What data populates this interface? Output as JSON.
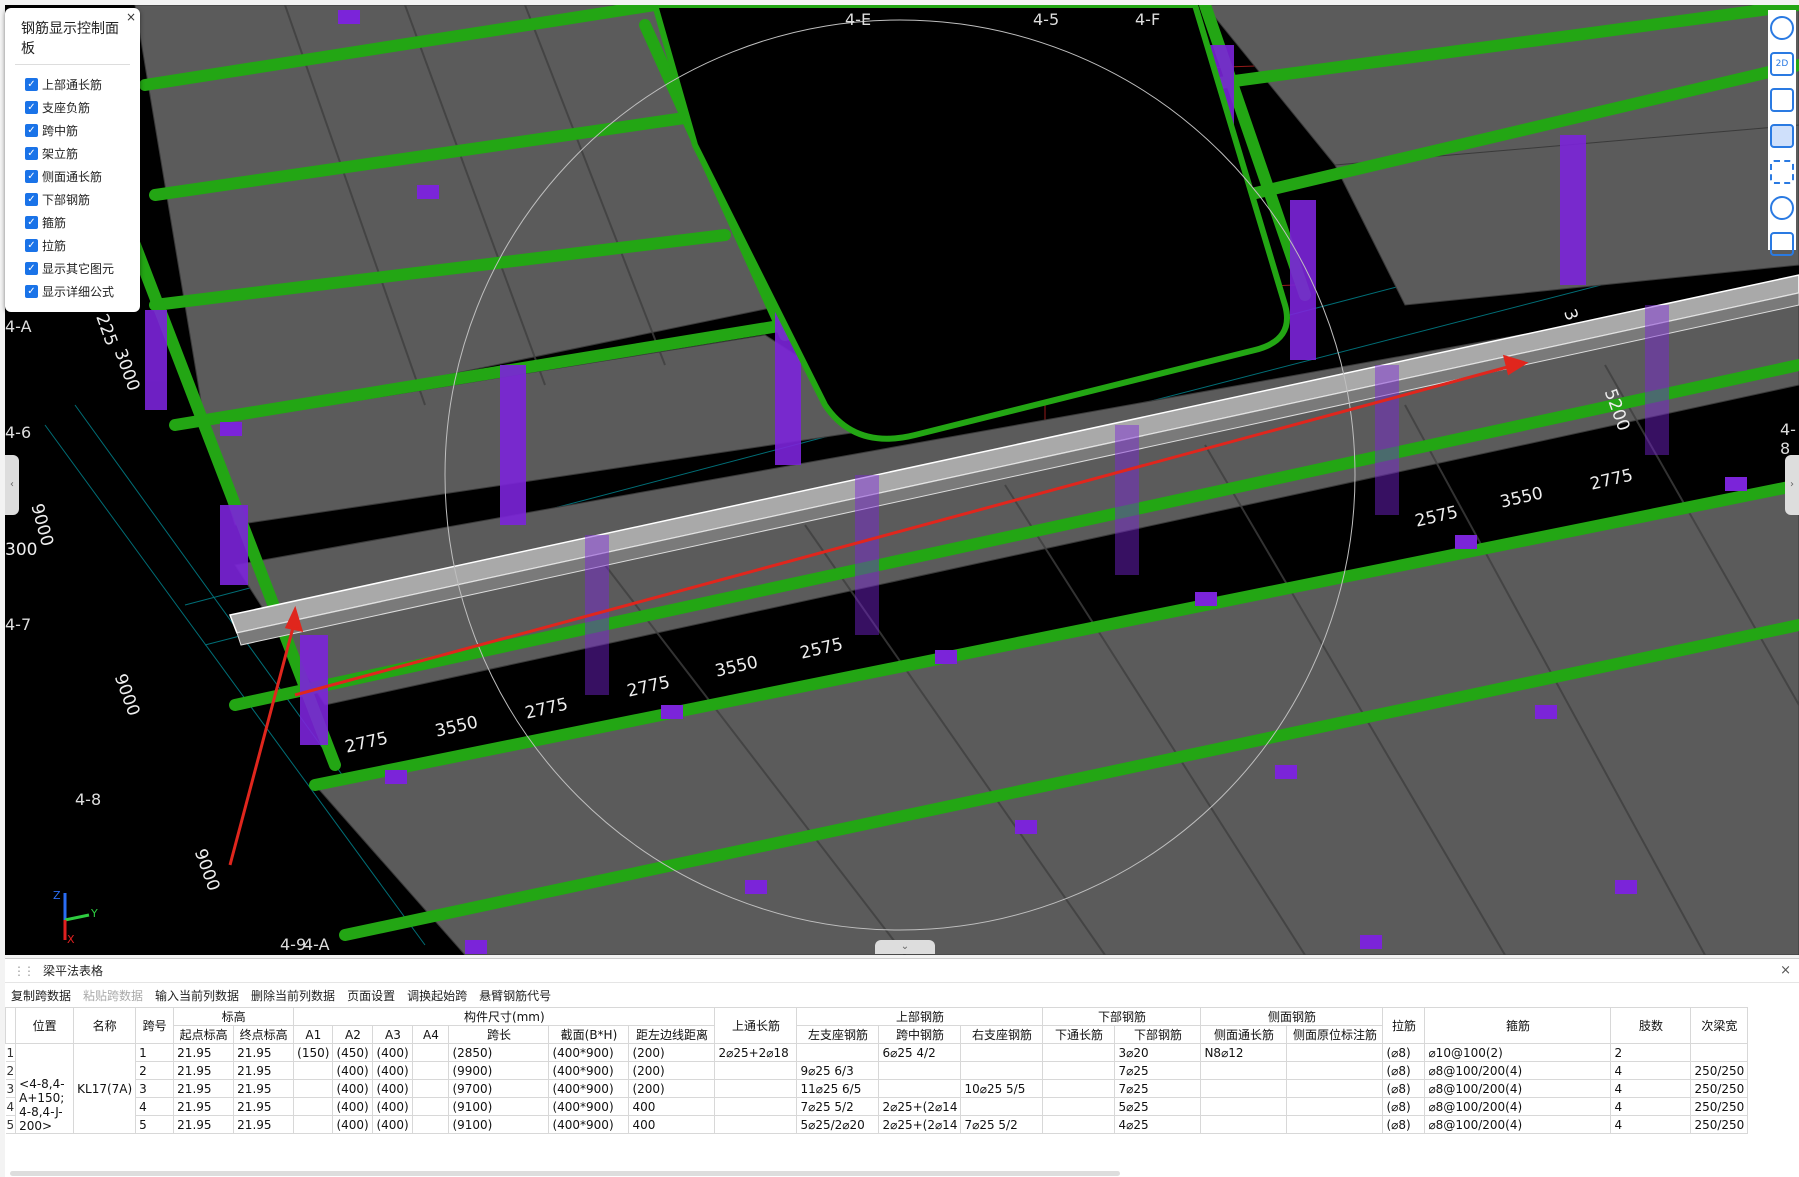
{
  "colors": {
    "beam_green": "#23a614",
    "column_purple": "#7b24d9",
    "slab_gray": "#5b5b5b",
    "cad_cyan": "#00c8d8",
    "arrow_red": "#e0261d",
    "accent_blue": "#1a73e8"
  },
  "rebar_panel": {
    "title": "钢筋显示控制面板",
    "close_label": "×",
    "options": [
      {
        "label": "上部通长筋",
        "checked": true
      },
      {
        "label": "支座负筋",
        "checked": true
      },
      {
        "label": "跨中筋",
        "checked": true
      },
      {
        "label": "架立筋",
        "checked": true
      },
      {
        "label": "侧面通长筋",
        "checked": true
      },
      {
        "label": "下部钢筋",
        "checked": true
      },
      {
        "label": "箍筋",
        "checked": true
      },
      {
        "label": "拉筋",
        "checked": true
      },
      {
        "label": "显示其它图元",
        "checked": true
      },
      {
        "label": "显示详细公式",
        "checked": true
      }
    ]
  },
  "right_toolbar": {
    "icons": [
      "orbit-icon",
      "2d-view-icon",
      "3d-box-icon",
      "solid-box-icon",
      "fullscreen-icon",
      "settings-icon",
      "report-icon"
    ],
    "labels": [
      "",
      "2D",
      "",
      "",
      "",
      "",
      ""
    ]
  },
  "scene": {
    "axis_labels": [
      "4-E",
      "4-5",
      "4-F",
      "4-A",
      "4-6",
      "4-7",
      "4-8",
      "4-9",
      "4-A",
      "4-8"
    ],
    "dimension_labels": [
      "2775",
      "3550",
      "2775",
      "2775",
      "3550",
      "2575",
      "2575",
      "3550",
      "2775",
      "9000",
      "9000",
      "9000",
      "3000",
      "5200",
      "300",
      "225",
      "3"
    ],
    "axis_widget": {
      "x": "X",
      "y": "Y",
      "z": "Z"
    }
  },
  "table_panel": {
    "title": "梁平法表格",
    "close_label": "×",
    "toolbar": [
      {
        "label": "复制跨数据",
        "enabled": true
      },
      {
        "label": "粘贴跨数据",
        "enabled": false
      },
      {
        "label": "输入当前列数据",
        "enabled": true
      },
      {
        "label": "删除当前列数据",
        "enabled": true
      },
      {
        "label": "页面设置",
        "enabled": true
      },
      {
        "label": "调换起始跨",
        "enabled": true
      },
      {
        "label": "悬臂钢筋代号",
        "enabled": true
      }
    ],
    "header_groups": {
      "position": "位置",
      "name": "名称",
      "span_no": "跨号",
      "elevation": "标高",
      "elevation_start": "起点标高",
      "elevation_end": "终点标高",
      "dims": "构件尺寸(mm)",
      "a1": "A1",
      "a2": "A2",
      "a3": "A3",
      "a4": "A4",
      "span_len": "跨长",
      "section": "截面(B*H)",
      "offset": "距左边线距离",
      "top_through": "上通长筋",
      "top_rebar": "上部钢筋",
      "left_support": "左支座钢筋",
      "mid_span": "跨中钢筋",
      "right_support": "右支座钢筋",
      "bottom_rebar": "下部钢筋",
      "bottom_through": "下通长筋",
      "bottom_steel": "下部钢筋",
      "side_rebar": "侧面钢筋",
      "side_through": "侧面通长筋",
      "side_original": "侧面原位标注筋",
      "tie": "拉筋",
      "stirrup": "箍筋",
      "legs": "肢数",
      "sub_beam_width": "次梁宽"
    },
    "position_value": "<4-8,4-A+150;4-8,4-J-200>",
    "name_value": "KL17(7A)",
    "rows": [
      {
        "idx": "1",
        "span": "1",
        "start": "21.95",
        "end": "21.95",
        "a1": "(150)",
        "a2": "(450)",
        "a3": "(400)",
        "a4": "",
        "len": "(2850)",
        "sec": "(400*900)",
        "off": "(200)",
        "top": "2⌀25+2⌀18",
        "left": "",
        "mid": "6⌀25 4/2",
        "right": "",
        "bthru": "",
        "bot": "3⌀20",
        "sthru": "N8⌀12",
        "sorig": "",
        "tie": "(⌀8)",
        "stir": "⌀10@100(2)",
        "legs": "2",
        "subw": ""
      },
      {
        "idx": "2",
        "span": "2",
        "start": "21.95",
        "end": "21.95",
        "a1": "",
        "a2": "(400)",
        "a3": "(400)",
        "a4": "",
        "len": "(9900)",
        "sec": "(400*900)",
        "off": "(200)",
        "top": "",
        "left": "9⌀25 6/3",
        "mid": "",
        "right": "",
        "bthru": "",
        "bot": "7⌀25",
        "sthru": "",
        "sorig": "",
        "tie": "(⌀8)",
        "stir": "⌀8@100/200(4)",
        "legs": "4",
        "subw": "250/250"
      },
      {
        "idx": "3",
        "span": "3",
        "start": "21.95",
        "end": "21.95",
        "a1": "",
        "a2": "(400)",
        "a3": "(400)",
        "a4": "",
        "len": "(9700)",
        "sec": "(400*900)",
        "off": "(200)",
        "top": "",
        "left": "11⌀25 6/5",
        "mid": "",
        "right": "10⌀25 5/5",
        "bthru": "",
        "bot": "7⌀25",
        "sthru": "",
        "sorig": "",
        "tie": "(⌀8)",
        "stir": "⌀8@100/200(4)",
        "legs": "4",
        "subw": "250/250"
      },
      {
        "idx": "4",
        "span": "4",
        "start": "21.95",
        "end": "21.95",
        "a1": "",
        "a2": "(400)",
        "a3": "(400)",
        "a4": "",
        "len": "(9100)",
        "sec": "(400*900)",
        "off": "400",
        "top": "",
        "left": "7⌀25 5/2",
        "mid": "2⌀25+(2⌀14",
        "right": "",
        "bthru": "",
        "bot": "5⌀25",
        "sthru": "",
        "sorig": "",
        "tie": "(⌀8)",
        "stir": "⌀8@100/200(4)",
        "legs": "4",
        "subw": "250/250"
      },
      {
        "idx": "5",
        "span": "5",
        "start": "21.95",
        "end": "21.95",
        "a1": "",
        "a2": "(400)",
        "a3": "(400)",
        "a4": "",
        "len": "(9100)",
        "sec": "(400*900)",
        "off": "400",
        "top": "",
        "left": "5⌀25/2⌀20",
        "mid": "2⌀25+(2⌀14",
        "right": "7⌀25 5/2",
        "bthru": "",
        "bot": "4⌀25",
        "sthru": "",
        "sorig": "",
        "tie": "(⌀8)",
        "stir": "⌀8@100/200(4)",
        "legs": "4",
        "subw": "250/250"
      }
    ]
  }
}
